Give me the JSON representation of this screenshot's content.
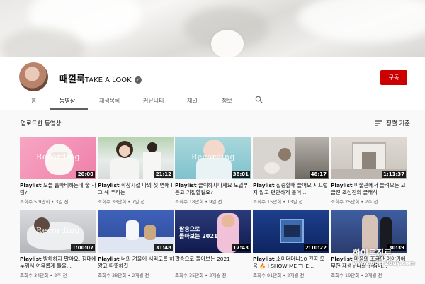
{
  "channel": {
    "name_ko": "때껄룩",
    "name_en": "TAKE A LOOK",
    "subscribe_label": "구독"
  },
  "tabs": [
    "홈",
    "동영상",
    "재생목록",
    "커뮤니티",
    "채널",
    "정보"
  ],
  "section": {
    "title": "업로드한 동영상",
    "sort_label": "정렬 기준"
  },
  "videos": [
    {
      "prefix": "Playlist",
      "title": "오늘 홈파티하는데 술 사람?",
      "meta": "조회수 5.9만회 • 3일 전",
      "duration": "20:00",
      "overlay": "Recording"
    },
    {
      "prefix": "Playlist",
      "title": "학창시절 나의 첫 연애 I 그 해 우리는",
      "meta": "조회수 33만회 • 7일 전",
      "duration": "21:12",
      "overlay": ""
    },
    {
      "prefix": "Playlist",
      "title": "클릭하지마세요 도입부 듣고 기절할걸요?",
      "meta": "조회수 18만회 • 9일 전",
      "duration": "38:01",
      "overlay": "Recording"
    },
    {
      "prefix": "Playlist",
      "title": "집중할때 들어요 시끄럽지 않고 편안하게 틀어...",
      "meta": "조회수 15만회 • 13일 전",
      "duration": "48:17",
      "overlay": ""
    },
    {
      "prefix": "Playlist",
      "title": "미술관에서 들려오는 고급진 조성진의 클래식",
      "meta": "조회수 25만회 • 2주 전",
      "duration": "1:11:37",
      "overlay": ""
    },
    {
      "prefix": "Playlist",
      "title": "방해하지 말아요, 침대에 누워서 여유롭게 들을...",
      "meta": "조회수 34만회 • 2주 전",
      "duration": "1:00:07",
      "overlay": "Recording"
    },
    {
      "prefix": "Playlist",
      "title": "너의 겨울이 시리도록 허왕고 따뜻하길",
      "meta": "조회수 38만회 • 2개월 전",
      "duration": "31:48",
      "overlay": ""
    },
    {
      "prefix": "",
      "title": "팝송으로 돌아보는 2021",
      "meta": "조회수 35만회 • 2개월 전",
      "duration": "17:43",
      "overlay": "팝송으로\n돌아보는 2021"
    },
    {
      "prefix": "Playlist",
      "title": "소미더머니10 전곡 모음 🔥 I SHOW ME THE...",
      "meta": "조회수 91만회 • 2개월 전",
      "duration": "2:10:22",
      "overlay": ""
    },
    {
      "prefix": "Playlist",
      "title": "마음의 조금만 이야기에 무한 재생 I 나의 진심이...",
      "meta": "조회수 19만회 • 2개월 전",
      "duration": "30:39",
      "overlay": ""
    }
  ],
  "watermark": {
    "logo": "하이트진로",
    "url": "www.beer2day.com"
  },
  "colors": {
    "subscribe": "#cc0000",
    "background": "#f9f9f9"
  }
}
